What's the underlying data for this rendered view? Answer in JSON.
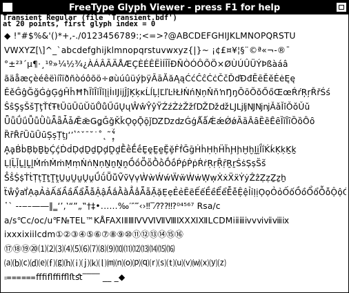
{
  "window": {
    "title": "FreeType Glyph Viewer - press F1 for help"
  },
  "status": {
    "line1": "Transient Regular (file `Transient.bdf')",
    "line2": "at 20 points, first glyph index = 0"
  },
  "glyph_lines": [
    "◆ !\"#$%&'()*+,-./0123456789:;<=>?@ABCDEFGHIJKLMNOPQRSTU",
    "VWXYZ[\\]^_`abcdefghijklmnopqrstuvwxyz{|}~ ¡¢£¤¥¦§¨©ª«¬-®¯",
    "°±²³´µ¶·¸¹º»¼½¾¿ÀÁÂÃÄÅÆÇÈÉÊËÌÍÎÏÐÑÒÓÔÕÖ×ØÙÚÛÜÝÞßàáâ",
    "ãäåæçèéêëìíîïðñòóôõö÷øùúûüýþÿĀāĂăĄąĆćĈĉĊċČčĎďĐđĒēĔĕĖėĘę",
    "ĚěĜĝĞğĠġĢģĤĥĦħĨĩĪīĬĭĮįİıĲĳĴĵĶķĸĹĺĻļĽľĿŀŁłŃńŅņŇňŉŊŋŌōŎŏŐőŒœŔŕŖŗŘřŚś",
    "ŜŝŞşŠšŢţŤťŦŧŨũŪūŬŭŮůŰűŲųŴŵŶŷŸŹźŻżŽžſǄǅǆǇǈǉǊǋǌǍǎǏǐǑǒǓǔ",
    "ǕǖǗǘǙǚǛǜǞǟǠǡǢǣǤǥǦǧǨǩǪǫǬǭǰǱǲǳǴǵǺǻǼǽǾǿȀȁȂȃȄȅȆȇȈȉȊȋȌȍȎȏ",
    "ȐȑȒȓȔȕȖȗȘșȚțȷʻʼʽˆˇˉ˘˙˚˛˜˝̧̨̦̀́̂̃̄̆̇̈̊̋̌̒",
    "ḀḁḂḃḄḅḆḇḈḉḊḋḌḍḎḏḐḑḒḓḔḕḖḗḘḙḚḛḜḝḞḟḠḡḢḣḤḥḦḧḨḩḪḫḬḭḮḯḰḱḲḳḴḵ",
    "ḶḷḸḹḺḻḼḽḾḿṀṁṂṃṄṅṆṇṈṉṊṋṌṍṎṏṐṑṒṓṔṕṖṗṘṙṚṛṜṝṞṟṠṡṢṣṤṥ",
    "ṦṧṨṩṪṫṬṭṮṯṰṱṲṳṴṵṶṷṸṹṺṻṼṽṾṿẀẁẂẃẄẅẆẇẈẉẊẋẌẍẎẏẐẑẒẓẔẕẖ",
    "ẗẘẙẚẛẠạẢảẤấẦầẨẩẪẫẬậẮắẰằẲẳẴẵẶặẸẹẺẻẼẽẾếỀềỂểỄễỆệỈỉỊịỌọỎỏỐốỒồỔổỖỗỘộỚớỜờỞởỠỡỢợỤụỦủỨứỪừỬửỮữỰựỲỳỴỵỶỷỸỹ",
    "῾` ‐‑‒–—―‖‗‘’‚‛“”„‟†‡•․‥…‰′″‴‹›‼‾⁄⁇⁈⁉⁰⁴⁵⁶⁷ Rsa/c",
    "a/s℃c/oc/u℉№TEL™KÅFAXⅠⅡⅢⅣⅤⅥⅦⅧⅨⅩⅪⅫⅬCDMⅰⅱⅲⅳⅴⅵⅶⅷⅸ",
    "ixxxixiilcdm①②③④⑤⑥⑦⑧⑨⑩⑪⑫⑬⑭⑮⑯",
    "⑰⑱⑲⑳⑴⑵⑶⑷⑸⑹⑺⑻⑼⑽⑾⑿⒀⒁⒂⒃",
    "⒜⒝⒞⒟⒠⒡⒢⒣⒤⒥⒦⒧⒨⒩⒪⒫⒬⒭⒮⒯⒰⒱⒲⒳⒴⒵",
    "⩴⩵⩶ﬀﬁﬂﬃﬄﬅﬆ‾‾‾‾ __ _◆"
  ]
}
